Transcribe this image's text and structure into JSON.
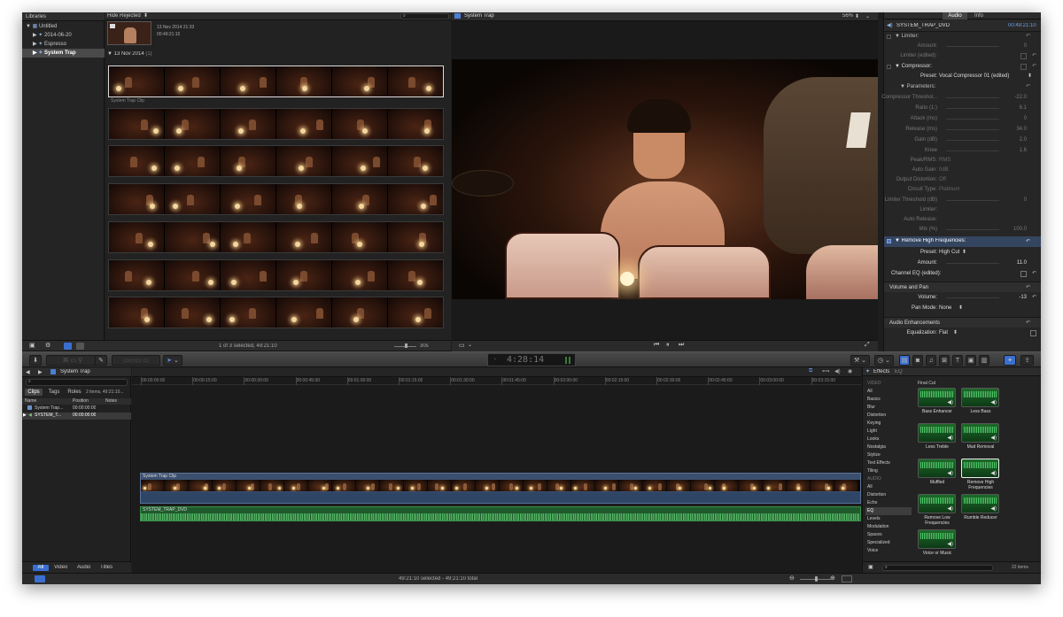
{
  "libraries": {
    "header": "Libraries",
    "items": [
      {
        "label": "Untitled"
      },
      {
        "label": "2014-06-20"
      },
      {
        "label": "Espresso"
      },
      {
        "label": "System Trap"
      }
    ]
  },
  "browser": {
    "filter": "Hide Rejected",
    "top_clip": {
      "date": "13 Nov 2014 21:33",
      "duration": "00:49:21:10"
    },
    "group": {
      "label": "13 Nov 2014",
      "count": "(1)"
    },
    "clip_name": "System Trap Clip",
    "selection_status": "1 of 3 selected, 49:21:10",
    "zoom": "30s"
  },
  "viewer": {
    "title": "System Trap",
    "zoom": "56%"
  },
  "inspector": {
    "tabs": {
      "audio": "Audio",
      "info": "Info"
    },
    "clip_name": "SYSTEM_TRAP_DVD",
    "timecode": "00:49:21:10",
    "limiter": "Limiter:",
    "amount_label": "Amount:",
    "amount_value": "0",
    "limiter_edited": "Limiter (edited):",
    "compressor": "Compressor:",
    "preset_label": "Preset:",
    "preset_value": "Vocal Compressor 01 (edited)",
    "parameters": "Parameters:",
    "params": [
      {
        "label": "Compressor Threshol...",
        "value": "-22.0"
      },
      {
        "label": "Ratio (1:)",
        "value": "6.1"
      },
      {
        "label": "Attack (ms)",
        "value": "0"
      },
      {
        "label": "Release (ms)",
        "value": "34.0"
      },
      {
        "label": "Gain (dB)",
        "value": "2.0"
      },
      {
        "label": "Knee",
        "value": "1.6"
      }
    ],
    "params2": [
      {
        "label": "Peak/RMS:",
        "value": "RMS"
      },
      {
        "label": "Auto Gain:",
        "value": "0dB"
      },
      {
        "label": "Output Distortion:",
        "value": "Off"
      },
      {
        "label": "Circuit Type:",
        "value": "Platinum"
      }
    ],
    "limiter_threshold": {
      "label": "Limiter Threshold (dB)",
      "value": "0"
    },
    "limiter2": "Limiter:",
    "auto_release": "Auto Release:",
    "mix": {
      "label": "Mix (%)",
      "value": "100.0"
    },
    "rhf": "Remove High Frequencies:",
    "rhf_preset_label": "Preset:",
    "rhf_preset_value": "High Cut",
    "rhf_amount_label": "Amount:",
    "rhf_amount_value": "11.0",
    "channel_eq": "Channel EQ (edited):",
    "volume_pan": "Volume and Pan",
    "volume_label": "Volume:",
    "volume_value": "-13",
    "pan_label": "Pan Mode:",
    "pan_value": "None",
    "audio_enh": "Audio Enhancements",
    "eq_label": "Equalization:",
    "eq_value": "Flat"
  },
  "toolbar": {
    "timecode": "4:28:14"
  },
  "timeline_index": {
    "title": "System Trap",
    "tabs": [
      "Clips",
      "Tags",
      "Roles"
    ],
    "summary": "2 items, 49:21:10...",
    "columns": [
      "Name",
      "Position",
      "Notes"
    ],
    "rows": [
      {
        "name": "System Trap...",
        "position": "00:00:00:00"
      },
      {
        "name": "SYSTEM_T...",
        "position": "00:00:00:00"
      }
    ],
    "filters": [
      "All",
      "Video",
      "Audio",
      "Titles"
    ]
  },
  "timeline": {
    "ruler": [
      "00:00:00:00",
      "00:00:15:00",
      "00:00:30:00",
      "00:00:45:00",
      "00:01:00:00",
      "00:01:15:00",
      "00:01:30:00",
      "00:01:45:00",
      "00:02:00:00",
      "00:02:15:00",
      "00:02:30:00",
      "00:02:45:00",
      "00:03:00:00",
      "00:03:15:00"
    ],
    "video_clip": "System Trap Clip",
    "audio_clip": "SYSTEM_TRAP_DVD"
  },
  "effects": {
    "title": "Effects",
    "subtitle": "EQ",
    "categories": [
      {
        "label": "VIDEO",
        "type": "head"
      },
      {
        "label": "All"
      },
      {
        "label": "Basics"
      },
      {
        "label": "Blur"
      },
      {
        "label": "Distortion"
      },
      {
        "label": "Keying"
      },
      {
        "label": "Light"
      },
      {
        "label": "Looks"
      },
      {
        "label": "Nostalgia"
      },
      {
        "label": "Stylize"
      },
      {
        "label": "Text Effects"
      },
      {
        "label": "Tiling"
      },
      {
        "label": "AUDIO",
        "type": "head"
      },
      {
        "label": "All"
      },
      {
        "label": "Distortion"
      },
      {
        "label": "Echo"
      },
      {
        "label": "EQ",
        "type": "sel"
      },
      {
        "label": "Levels"
      },
      {
        "label": "Modulation"
      },
      {
        "label": "Spaces"
      },
      {
        "label": "Specialized"
      },
      {
        "label": "Voice"
      }
    ],
    "group": "Final Cut",
    "tiles": [
      {
        "label": "Bass Enhancer"
      },
      {
        "label": "Less Bass"
      },
      {
        "label": "Less Treble"
      },
      {
        "label": "Mud Removal"
      },
      {
        "label": "Muffled"
      },
      {
        "label": "Remove High Frequencies"
      },
      {
        "label": "Remove Low Frequencies"
      },
      {
        "label": "Rumble Reducer"
      },
      {
        "label": "Voice or Music"
      }
    ],
    "count": "22 items"
  },
  "status": {
    "selection": "49:21:10 selected - 49:21:10 total"
  }
}
